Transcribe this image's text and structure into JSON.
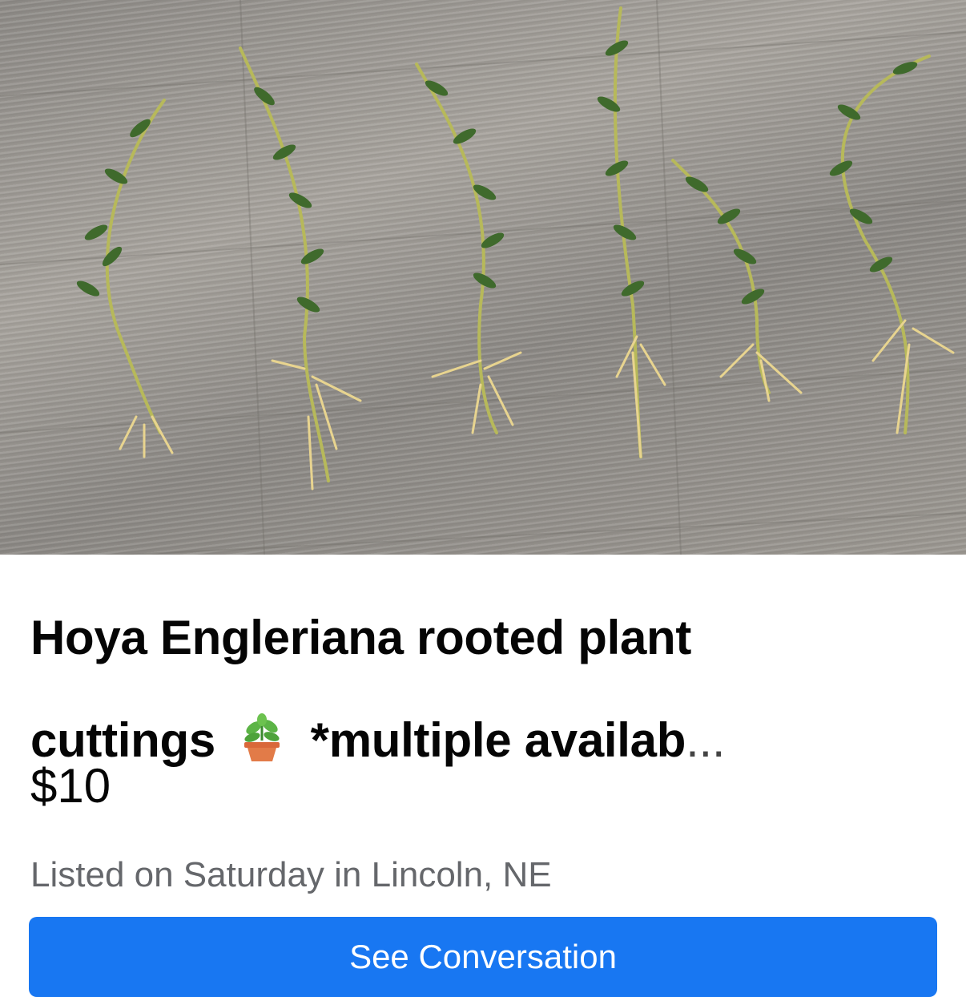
{
  "listing": {
    "photo_alt": "Hoya Engleriana rooted plant cuttings on wood floor",
    "title_line1": "Hoya Engleriana rooted plant",
    "title_line2_a": "cuttings",
    "title_emoji": "potted-plant-emoji",
    "title_line2_b": "*multiple availab",
    "title_ellipsis": "...",
    "price": "$10",
    "listed_text": "Listed on Saturday in Lincoln, NE"
  },
  "actions": {
    "see_conversation_label": "See Conversation"
  },
  "colors": {
    "primary_button": "#1877f2",
    "title_text": "#050505",
    "meta_text": "#65676b"
  }
}
